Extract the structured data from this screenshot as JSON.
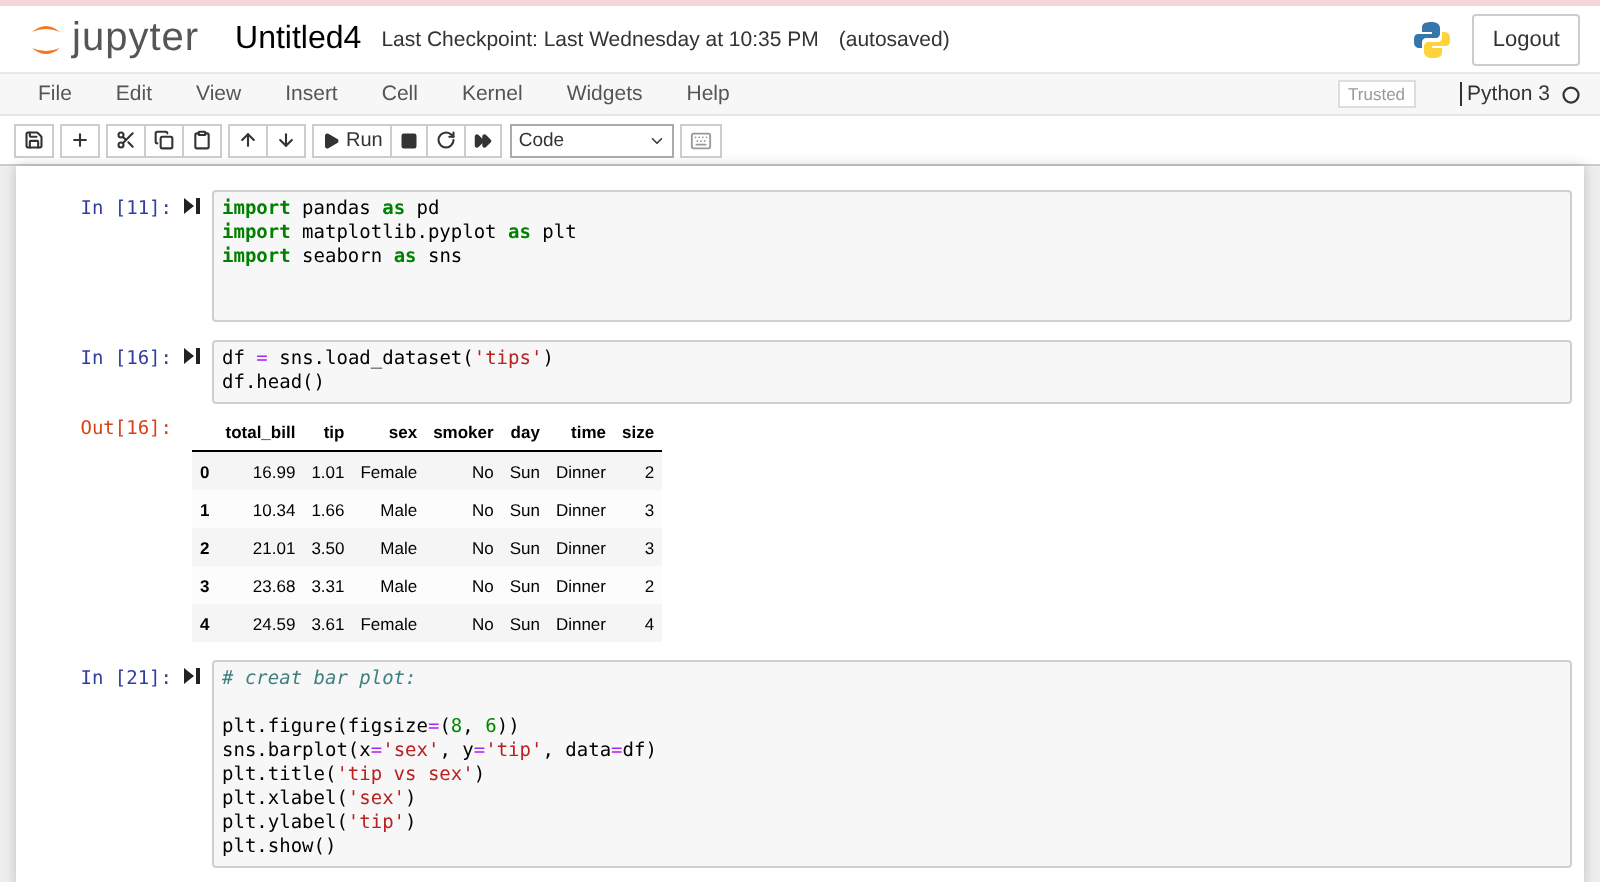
{
  "header": {
    "logo_text": "jupyter",
    "notebook_name": "Untitled4",
    "checkpoint": "Last Checkpoint: Last Wednesday at 10:35 PM",
    "autosave": "(autosaved)",
    "logout": "Logout"
  },
  "menu": [
    "File",
    "Edit",
    "View",
    "Insert",
    "Cell",
    "Kernel",
    "Widgets",
    "Help"
  ],
  "trusted": "Trusted",
  "kernel": "Python 3",
  "toolbar": {
    "run": "Run",
    "cell_type": "Code"
  },
  "cells": [
    {
      "prompt": "In [11]:",
      "blocks": [
        [
          [
            {
              "kind": "kw",
              "text": "import"
            },
            {
              "kind": "plain",
              "text": " pandas "
            },
            {
              "kind": "kw",
              "text": "as"
            },
            {
              "kind": "plain",
              "text": " pd"
            }
          ],
          [
            {
              "kind": "kw",
              "text": "import"
            },
            {
              "kind": "plain",
              "text": " matplotlib.pyplot "
            },
            {
              "kind": "kw",
              "text": "as"
            },
            {
              "kind": "plain",
              "text": " plt"
            }
          ],
          [
            {
              "kind": "kw",
              "text": "import"
            },
            {
              "kind": "plain",
              "text": " seaborn "
            },
            {
              "kind": "kw",
              "text": "as"
            },
            {
              "kind": "plain",
              "text": " sns"
            }
          ]
        ]
      ]
    },
    {
      "prompt": "In [16]:",
      "blocks": [
        [
          [
            {
              "kind": "plain",
              "text": "df "
            },
            {
              "kind": "op",
              "text": "="
            },
            {
              "kind": "plain",
              "text": " sns.load_dataset("
            },
            {
              "kind": "str",
              "text": "'tips'"
            },
            {
              "kind": "plain",
              "text": ")"
            }
          ],
          [
            {
              "kind": "plain",
              "text": "df.head()"
            }
          ]
        ]
      ],
      "output": {
        "prompt": "Out[16]:",
        "columns": [
          "",
          "total_bill",
          "tip",
          "sex",
          "smoker",
          "day",
          "time",
          "size"
        ],
        "rows": [
          [
            "0",
            "16.99",
            "1.01",
            "Female",
            "No",
            "Sun",
            "Dinner",
            "2"
          ],
          [
            "1",
            "10.34",
            "1.66",
            "Male",
            "No",
            "Sun",
            "Dinner",
            "3"
          ],
          [
            "2",
            "21.01",
            "3.50",
            "Male",
            "No",
            "Sun",
            "Dinner",
            "3"
          ],
          [
            "3",
            "23.68",
            "3.31",
            "Male",
            "No",
            "Sun",
            "Dinner",
            "2"
          ],
          [
            "4",
            "24.59",
            "3.61",
            "Female",
            "No",
            "Sun",
            "Dinner",
            "4"
          ]
        ]
      }
    },
    {
      "prompt": "In [21]:",
      "blocks": [
        [
          [
            {
              "kind": "comment",
              "text": "# creat bar plot:"
            }
          ]
        ],
        [
          [
            {
              "kind": "plain",
              "text": "plt.figure(figsize"
            },
            {
              "kind": "op",
              "text": "="
            },
            {
              "kind": "plain",
              "text": "("
            },
            {
              "kind": "num",
              "text": "8"
            },
            {
              "kind": "plain",
              "text": ", "
            },
            {
              "kind": "num",
              "text": "6"
            },
            {
              "kind": "plain",
              "text": "))"
            }
          ],
          [
            {
              "kind": "plain",
              "text": "sns.barplot(x"
            },
            {
              "kind": "op",
              "text": "="
            },
            {
              "kind": "str",
              "text": "'sex'"
            },
            {
              "kind": "plain",
              "text": ", y"
            },
            {
              "kind": "op",
              "text": "="
            },
            {
              "kind": "str",
              "text": "'tip'"
            },
            {
              "kind": "plain",
              "text": ", data"
            },
            {
              "kind": "op",
              "text": "="
            },
            {
              "kind": "plain",
              "text": "df)"
            }
          ],
          [
            {
              "kind": "plain",
              "text": "plt.title("
            },
            {
              "kind": "str",
              "text": "'tip vs sex'"
            },
            {
              "kind": "plain",
              "text": ")"
            }
          ],
          [
            {
              "kind": "plain",
              "text": "plt.xlabel("
            },
            {
              "kind": "str",
              "text": "'sex'"
            },
            {
              "kind": "plain",
              "text": ")"
            }
          ],
          [
            {
              "kind": "plain",
              "text": "plt.ylabel("
            },
            {
              "kind": "str",
              "text": "'tip'"
            },
            {
              "kind": "plain",
              "text": ")"
            }
          ],
          [
            {
              "kind": "plain",
              "text": "plt.show()"
            }
          ]
        ]
      ]
    }
  ]
}
